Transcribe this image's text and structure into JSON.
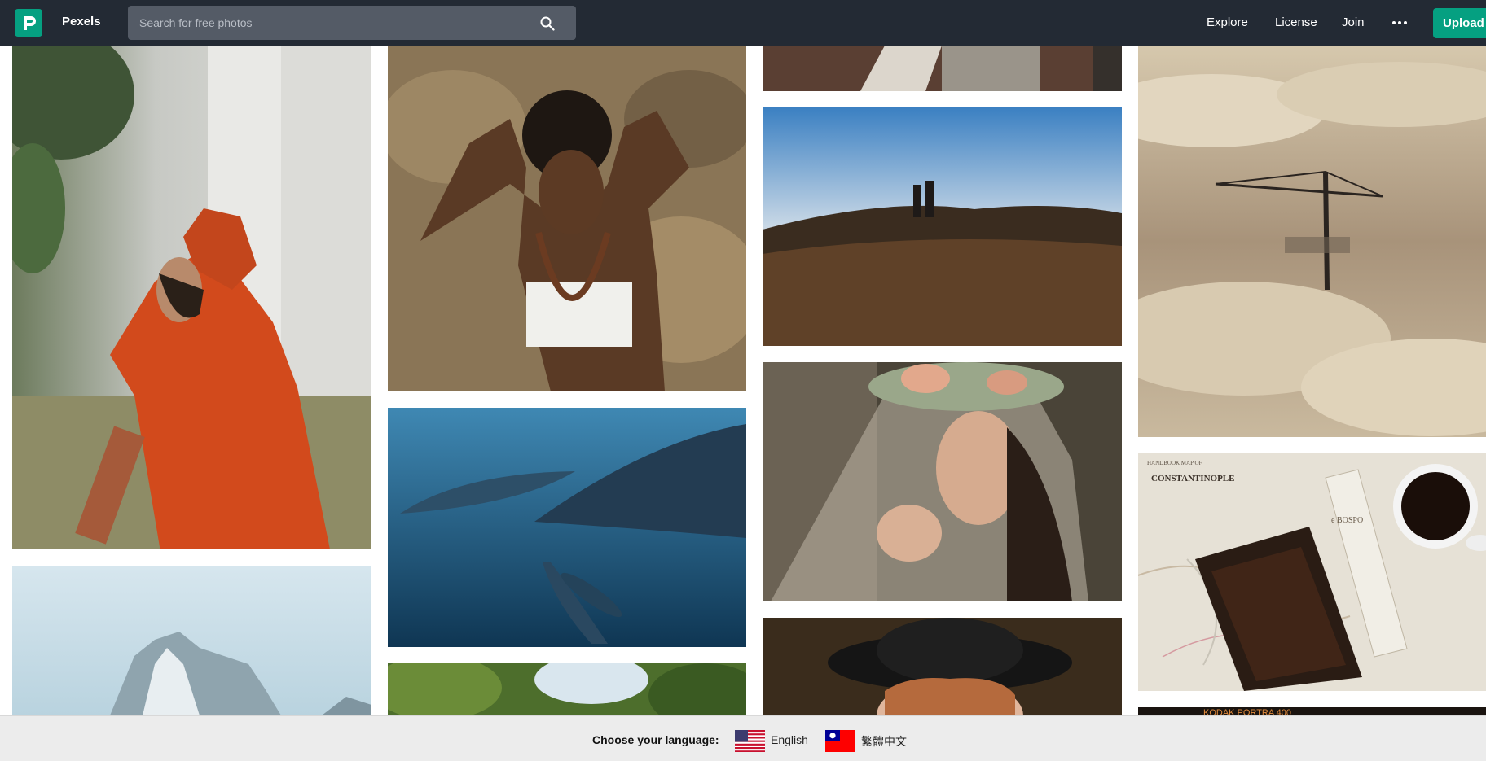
{
  "header": {
    "brand": "Pexels",
    "search_placeholder": "Search for free photos",
    "nav": {
      "explore": "Explore",
      "license": "License",
      "join": "Join"
    },
    "upload_label": "Upload",
    "accent": "#05a081",
    "background": "#232a34"
  },
  "photos": [
    {
      "name": "photo-man-orange-jacket"
    },
    {
      "name": "photo-mountain-peak"
    },
    {
      "name": "photo-woman-rock-wall"
    },
    {
      "name": "photo-dolphins"
    },
    {
      "name": "photo-forest"
    },
    {
      "name": "photo-stone-path"
    },
    {
      "name": "photo-couple-sunset"
    },
    {
      "name": "photo-woman-veil"
    },
    {
      "name": "photo-woman-hat"
    },
    {
      "name": "photo-crane-fog"
    },
    {
      "name": "photo-map-coffee",
      "text": {
        "map_title": "CONSTANTINOPLE",
        "map_header": "HANDBOOK MAP OF",
        "scroll_text": "e BOSPO"
      }
    },
    {
      "name": "photo-kodak-film",
      "text": {
        "film_text": "KODAK PORTRA 400"
      }
    }
  ],
  "language_bar": {
    "label": "Choose your language:",
    "options": [
      {
        "label": "English",
        "flag": "us-flag-icon"
      },
      {
        "label": "繁體中文",
        "flag": "taiwan-flag-icon"
      }
    ]
  }
}
